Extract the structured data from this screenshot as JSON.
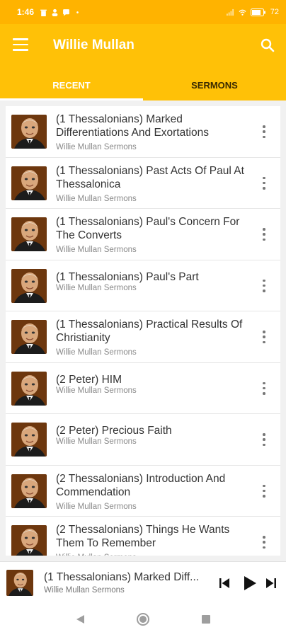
{
  "status_bar": {
    "time": "1:46",
    "battery": "72"
  },
  "app_bar": {
    "title": "Willie Mullan"
  },
  "tabs": [
    {
      "label": "RECENT",
      "active": true
    },
    {
      "label": "SERMONS",
      "active": false
    }
  ],
  "items": [
    {
      "title": "(1 Thessalonians) Marked Differentiations And Exortations",
      "subtitle": "Willie Mullan Sermons",
      "lines": 2
    },
    {
      "title": "(1 Thessalonians) Past Acts Of Paul At Thessalonica",
      "subtitle": "Willie Mullan Sermons",
      "lines": 2
    },
    {
      "title": "(1 Thessalonians) Paul's Concern For The Converts",
      "subtitle": "Willie Mullan Sermons",
      "lines": 2
    },
    {
      "title": "(1 Thessalonians) Paul's Part",
      "subtitle": "Willie Mullan Sermons",
      "lines": 1
    },
    {
      "title": "(1 Thessalonians) Practical Results Of Christianity",
      "subtitle": "Willie Mullan Sermons",
      "lines": 2
    },
    {
      "title": "(2 Peter) HIM",
      "subtitle": "Willie Mullan Sermons",
      "lines": 1
    },
    {
      "title": "(2 Peter) Precious Faith",
      "subtitle": "Willie Mullan Sermons",
      "lines": 1
    },
    {
      "title": "(2 Thessalonians) Introduction And Commendation",
      "subtitle": "Willie Mullan Sermons",
      "lines": 2
    },
    {
      "title": "(2 Thessalonians) Things He Wants Them To Remember",
      "subtitle": "Willie Mullan Sermons",
      "lines": 2
    }
  ],
  "player": {
    "title": "(1 Thessalonians) Marked Diff...",
    "subtitle": "Willie Mullan Sermons"
  },
  "colors": {
    "primary": "#ffc107",
    "status": "#ffb300"
  },
  "icons": [
    "menu-icon",
    "search-icon",
    "more-vert-icon",
    "skip-previous-icon",
    "play-icon",
    "skip-next-icon",
    "back-icon",
    "home-icon",
    "recents-icon"
  ]
}
